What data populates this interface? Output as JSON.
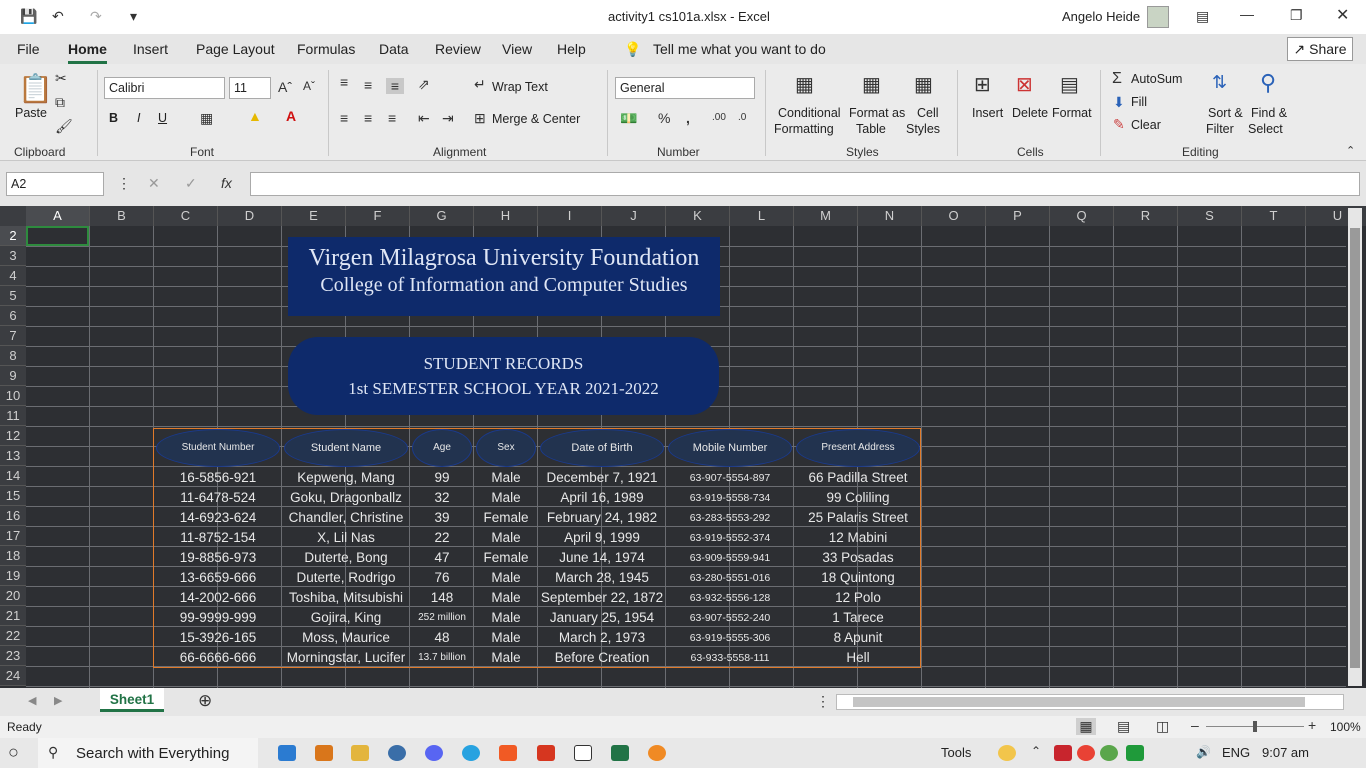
{
  "title_bar": {
    "file_title": "activity1 cs101a.xlsx  -  Excel",
    "user_name": "Angelo Heide"
  },
  "ribbon_tabs": [
    "File",
    "Home",
    "Insert",
    "Page Layout",
    "Formulas",
    "Data",
    "Review",
    "View",
    "Help"
  ],
  "tell_me": "Tell me what you want to do",
  "share_label": "Share",
  "ribbon": {
    "clipboard": {
      "paste": "Paste",
      "group": "Clipboard"
    },
    "font": {
      "name": "Calibri",
      "size": "11",
      "group": "Font",
      "bold": "B",
      "italic": "I",
      "underline": "U"
    },
    "alignment": {
      "wrap": "Wrap Text",
      "merge": "Merge & Center",
      "group": "Alignment"
    },
    "number": {
      "format": "General",
      "group": "Number"
    },
    "styles": {
      "conditional": "Conditional",
      "formatting": "Formatting",
      "format_as": "Format as",
      "table": "Table",
      "cell": "Cell",
      "cell_styles": "Styles",
      "group": "Styles"
    },
    "cells": {
      "insert": "Insert",
      "delete": "Delete",
      "format": "Format",
      "group": "Cells"
    },
    "editing": {
      "autosum": "AutoSum",
      "fill": "Fill",
      "clear": "Clear",
      "sort": "Sort &",
      "filter": "Filter",
      "find": "Find &",
      "select": "Select",
      "group": "Editing"
    }
  },
  "name_box": "A2",
  "fx": "fx",
  "columns": [
    "A",
    "B",
    "C",
    "D",
    "E",
    "F",
    "G",
    "H",
    "I",
    "J",
    "K",
    "L",
    "M",
    "N",
    "O",
    "P",
    "Q",
    "R",
    "S",
    "T",
    "U"
  ],
  "rows": [
    "2",
    "3",
    "4",
    "5",
    "6",
    "7",
    "8",
    "9",
    "10",
    "11",
    "12",
    "13",
    "14",
    "15",
    "16",
    "17",
    "18",
    "19",
    "20",
    "21",
    "22",
    "23",
    "24"
  ],
  "banner1": {
    "line1": "Virgen Milagrosa University Foundation",
    "line2": "College of Information and Computer Studies"
  },
  "banner2": {
    "line1": "STUDENT RECORDS",
    "line2": "1st SEMESTER SCHOOL YEAR 2021-2022"
  },
  "table": {
    "headers": [
      "Student Number",
      "Student Name",
      "Age",
      "Sex",
      "Date of Birth",
      "Mobile Number",
      "Present Address"
    ],
    "rows": [
      [
        "16-5856-921",
        "Kepweng, Mang",
        "99",
        "Male",
        "December 7, 1921",
        "63-907-5554-897",
        "66 Padilla Street"
      ],
      [
        "11-6478-524",
        "Goku, Dragonballz",
        "32",
        "Male",
        "April 16,  1989",
        "63-919-5558-734",
        "99 Coliling"
      ],
      [
        "14-6923-624",
        "Chandler, Christine",
        "39",
        "Female",
        "February 24, 1982",
        "63-283-5553-292",
        "25 Palaris Street"
      ],
      [
        "11-8752-154",
        "X, Lil Nas",
        "22",
        "Male",
        "April 9, 1999",
        "63-919-5552-374",
        "12 Mabini"
      ],
      [
        "19-8856-973",
        "Duterte, Bong",
        "47",
        "Female",
        "June 14, 1974",
        "63-909-5559-941",
        "33 Posadas"
      ],
      [
        "13-6659-666",
        "Duterte, Rodrigo",
        "76",
        "Male",
        "March 28, 1945",
        "63-280-5551-016",
        "18 Quintong"
      ],
      [
        "14-2002-666",
        "Toshiba, Mitsubishi",
        "148",
        "Male",
        "September 22, 1872",
        "63-932-5556-128",
        "12 Polo"
      ],
      [
        "99-9999-999",
        "Gojira, King",
        "252 million",
        "Male",
        "January 25, 1954",
        "63-907-5552-240",
        "1 Tarece"
      ],
      [
        "15-3926-165",
        "Moss, Maurice",
        "48",
        "Male",
        "March 2, 1973",
        "63-919-5555-306",
        "8 Apunit"
      ],
      [
        "66-6666-666",
        "Morningstar, Lucifer",
        "13.7 billion",
        "Male",
        "Before Creation",
        "63-933-5558-111",
        "Hell"
      ]
    ]
  },
  "sheet_tab": "Sheet1",
  "status": {
    "ready": "Ready",
    "zoom": "100%"
  },
  "taskbar": {
    "search": "Search with Everything",
    "tools": "Tools",
    "lang": "ENG",
    "time": "9:07 am"
  }
}
